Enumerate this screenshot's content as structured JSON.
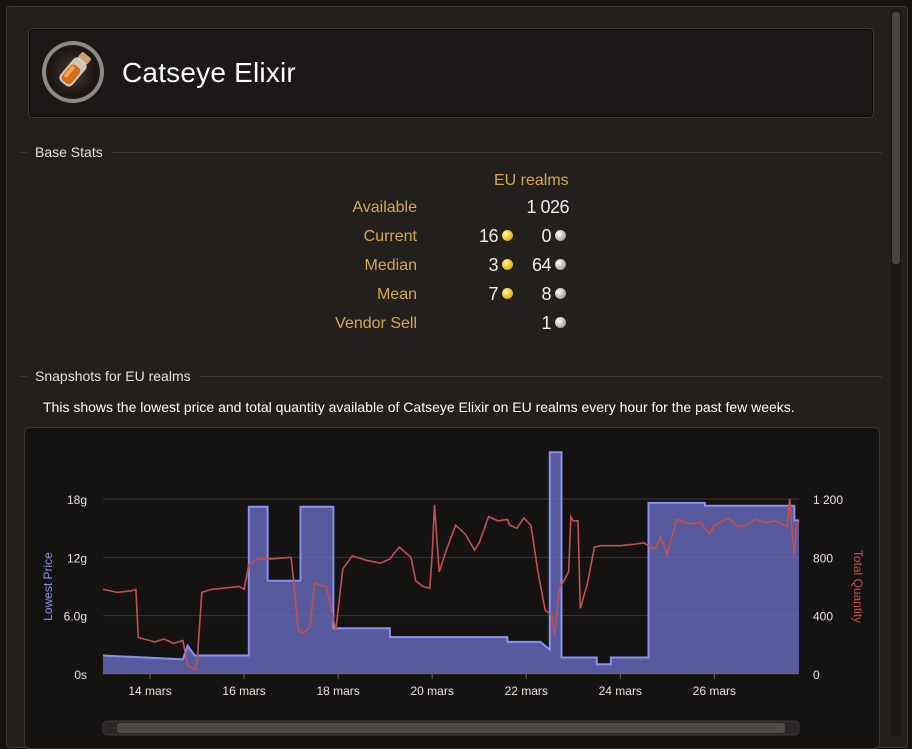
{
  "item": {
    "name": "Catseye Elixir",
    "icon": "potion-icon"
  },
  "sections": {
    "base_stats": "Base Stats",
    "snapshots": "Snapshots for EU realms",
    "description": "This shows the lowest price and total quantity available of Catseye Elixir on EU realms every hour for the past few weeks."
  },
  "stats": {
    "column_header": "EU realms",
    "rows": [
      {
        "label": "Available",
        "value": "1 026"
      },
      {
        "label": "Current",
        "gold": "16",
        "silver": "0"
      },
      {
        "label": "Median",
        "gold": "3",
        "silver": "64"
      },
      {
        "label": "Mean",
        "gold": "7",
        "silver": "8"
      },
      {
        "label": "Vendor Sell",
        "silver": "1"
      }
    ]
  },
  "colors": {
    "label_gold": "#d4aa48",
    "price_series": "#8b8ff0",
    "quantity_series": "#c25050",
    "background": "#221f1d"
  },
  "chart_data": {
    "type": "area",
    "x_unit": "day of March (hourly snapshots)",
    "xlim": [
      13,
      27.8
    ],
    "x_ticks": [
      {
        "x": 14,
        "label": "14 mars"
      },
      {
        "x": 16,
        "label": "16 mars"
      },
      {
        "x": 18,
        "label": "18 mars"
      },
      {
        "x": 20,
        "label": "20 mars"
      },
      {
        "x": 22,
        "label": "22 mars"
      },
      {
        "x": 24,
        "label": "24 mars"
      },
      {
        "x": 26,
        "label": "26 mars"
      }
    ],
    "ylabel_left": "Lowest Price",
    "ylabel_right": "Total Quantity",
    "ylim_left": [
      0,
      18
    ],
    "ylim_right": [
      0,
      1200
    ],
    "y_ticks_left": [
      {
        "v": 0,
        "label": "0s"
      },
      {
        "v": 6,
        "label": "6.0g"
      },
      {
        "v": 12,
        "label": "12g"
      },
      {
        "v": 18,
        "label": "18g"
      }
    ],
    "y_ticks_right": [
      {
        "v": 0,
        "label": "0"
      },
      {
        "v": 400,
        "label": "400"
      },
      {
        "v": 800,
        "label": "800"
      },
      {
        "v": 1200,
        "label": "1 200"
      }
    ],
    "grid": true,
    "series": [
      {
        "name": "Lowest Price",
        "axis": "left",
        "style": "step-area",
        "points": [
          [
            13,
            1.9
          ],
          [
            14.7,
            1.5
          ],
          [
            14.8,
            2.9
          ],
          [
            14.95,
            1.9
          ],
          [
            16.1,
            1.9
          ],
          [
            16.1,
            17.2
          ],
          [
            16.5,
            17.2
          ],
          [
            16.5,
            9.6
          ],
          [
            17.2,
            9.6
          ],
          [
            17.2,
            17.2
          ],
          [
            17.9,
            17.2
          ],
          [
            17.9,
            4.7
          ],
          [
            19.1,
            4.7
          ],
          [
            19.1,
            3.8
          ],
          [
            21.6,
            3.8
          ],
          [
            21.6,
            3.3
          ],
          [
            22.3,
            3.3
          ],
          [
            22.5,
            2.5
          ],
          [
            22.5,
            22.8
          ],
          [
            22.75,
            22.8
          ],
          [
            22.75,
            1.7
          ],
          [
            23.5,
            1.7
          ],
          [
            23.5,
            1.0
          ],
          [
            23.8,
            1.0
          ],
          [
            23.8,
            1.7
          ],
          [
            24.6,
            1.7
          ],
          [
            24.6,
            17.6
          ],
          [
            25.8,
            17.6
          ],
          [
            25.8,
            17.3
          ],
          [
            27.7,
            17.3
          ],
          [
            27.7,
            15.8
          ],
          [
            27.8,
            15.8
          ]
        ]
      },
      {
        "name": "Total Quantity",
        "axis": "right",
        "style": "line",
        "points": [
          [
            13,
            580
          ],
          [
            13.3,
            560
          ],
          [
            13.6,
            570
          ],
          [
            13.7,
            580
          ],
          [
            13.75,
            250
          ],
          [
            14.1,
            220
          ],
          [
            14.3,
            240
          ],
          [
            14.5,
            210
          ],
          [
            14.7,
            230
          ],
          [
            14.8,
            60
          ],
          [
            14.95,
            30
          ],
          [
            15.0,
            80
          ],
          [
            15.1,
            560
          ],
          [
            15.3,
            580
          ],
          [
            15.6,
            590
          ],
          [
            15.9,
            600
          ],
          [
            16.0,
            580
          ],
          [
            16.1,
            750
          ],
          [
            16.3,
            790
          ],
          [
            16.6,
            790
          ],
          [
            17.0,
            800
          ],
          [
            17.05,
            650
          ],
          [
            17.15,
            300
          ],
          [
            17.25,
            280
          ],
          [
            17.4,
            320
          ],
          [
            17.5,
            620
          ],
          [
            17.75,
            600
          ],
          [
            17.95,
            300
          ],
          [
            18.1,
            720
          ],
          [
            18.3,
            810
          ],
          [
            18.6,
            780
          ],
          [
            18.9,
            760
          ],
          [
            19.1,
            790
          ],
          [
            19.3,
            870
          ],
          [
            19.55,
            800
          ],
          [
            19.65,
            640
          ],
          [
            19.8,
            600
          ],
          [
            19.95,
            590
          ],
          [
            20.0,
            820
          ],
          [
            20.05,
            1160
          ],
          [
            20.15,
            700
          ],
          [
            20.3,
            850
          ],
          [
            20.5,
            1020
          ],
          [
            20.7,
            960
          ],
          [
            20.9,
            850
          ],
          [
            21.0,
            900
          ],
          [
            21.2,
            1080
          ],
          [
            21.4,
            1050
          ],
          [
            21.6,
            1060
          ],
          [
            21.65,
            1020
          ],
          [
            21.8,
            1000
          ],
          [
            21.95,
            1070
          ],
          [
            22.1,
            1020
          ],
          [
            22.25,
            700
          ],
          [
            22.4,
            440
          ],
          [
            22.55,
            400
          ],
          [
            22.6,
            260
          ],
          [
            22.7,
            580
          ],
          [
            22.9,
            700
          ],
          [
            22.95,
            1080
          ],
          [
            23.0,
            1050
          ],
          [
            23.1,
            1050
          ],
          [
            23.15,
            450
          ],
          [
            23.3,
            620
          ],
          [
            23.45,
            870
          ],
          [
            23.6,
            880
          ],
          [
            24.0,
            880
          ],
          [
            24.3,
            890
          ],
          [
            24.5,
            900
          ],
          [
            24.7,
            860
          ],
          [
            24.75,
            860
          ],
          [
            24.85,
            940
          ],
          [
            25.0,
            820
          ],
          [
            25.2,
            1060
          ],
          [
            25.45,
            1030
          ],
          [
            25.7,
            1040
          ],
          [
            25.9,
            960
          ],
          [
            26.0,
            1020
          ],
          [
            26.3,
            1070
          ],
          [
            26.5,
            1010
          ],
          [
            26.7,
            1020
          ],
          [
            26.85,
            1060
          ],
          [
            27.1,
            1040
          ],
          [
            27.3,
            1050
          ],
          [
            27.55,
            1010
          ],
          [
            27.6,
            1200
          ],
          [
            27.65,
            1000
          ],
          [
            27.7,
            820
          ],
          [
            27.75,
            1020
          ],
          [
            27.8,
            1050
          ]
        ]
      }
    ]
  }
}
